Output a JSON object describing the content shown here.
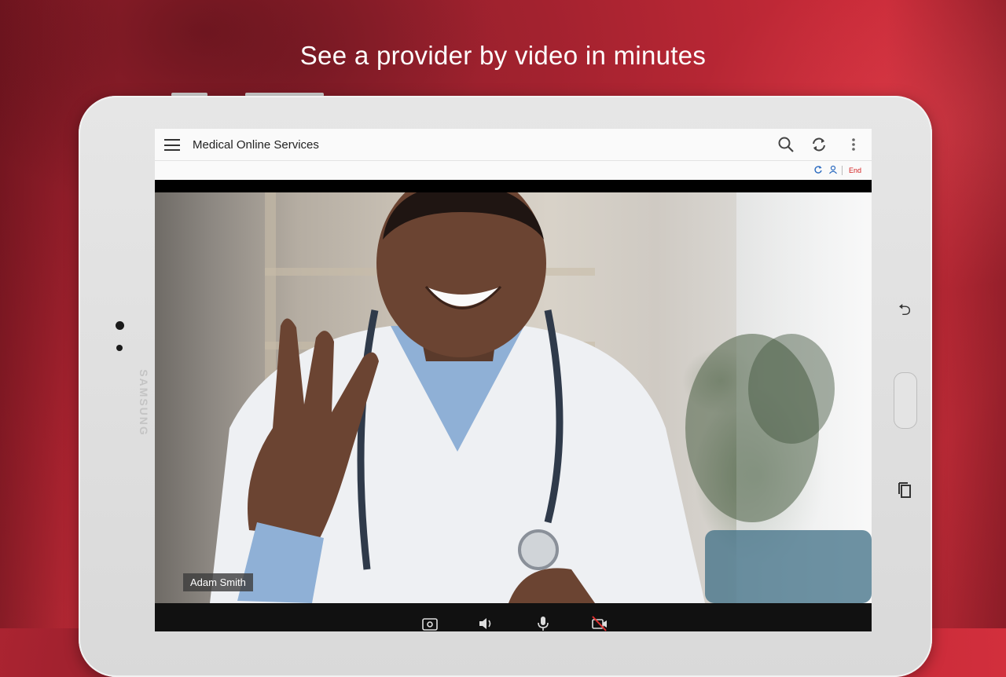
{
  "headline": "See a provider by video in minutes",
  "device": {
    "brand": "SAMSUNG"
  },
  "app": {
    "title": "Medical Online Services",
    "toolbar_icons": [
      "search-icon",
      "refresh-icon",
      "more-vert-icon"
    ],
    "subbar": {
      "icons": [
        "reload-icon",
        "user-switch-icon"
      ],
      "end_label": "End"
    }
  },
  "video_call": {
    "participant_name": "Adam Smith",
    "controls": [
      "switch-camera-icon",
      "speaker-icon",
      "microphone-icon",
      "video-off-icon"
    ]
  },
  "colors": {
    "background_red": "#c72a38",
    "end_red": "#d32020",
    "accent_blue": "#2d6cc0"
  }
}
